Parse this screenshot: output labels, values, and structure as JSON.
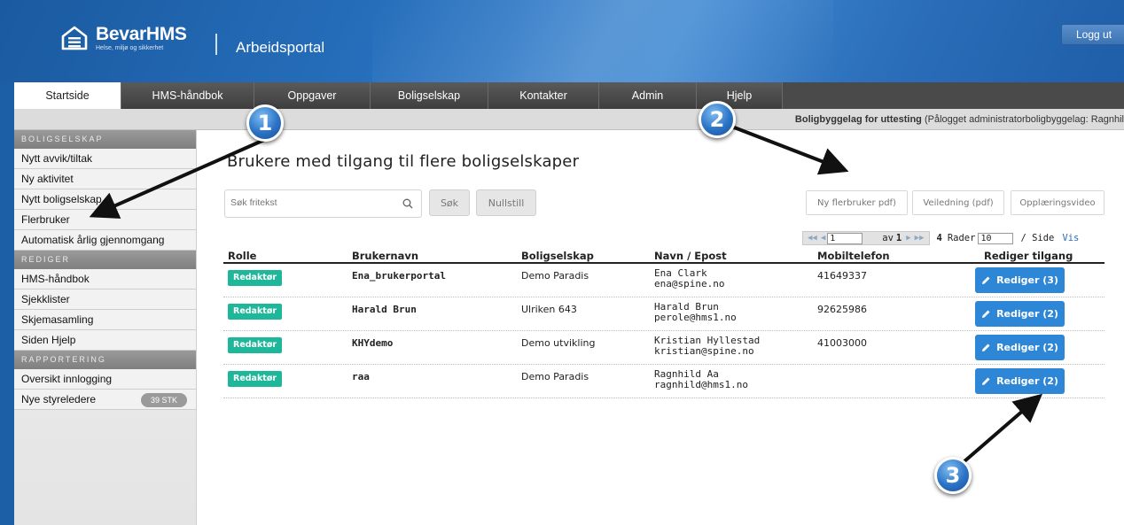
{
  "header": {
    "logo_name": "BevarHMS",
    "logo_tagline": "Helse, miljø og sikkerhet",
    "portal_title": "Arbeidsportal",
    "logout_label": "Logg ut"
  },
  "nav": {
    "items": [
      {
        "label": "Startside",
        "active": true
      },
      {
        "label": "HMS-håndbok"
      },
      {
        "label": "Oppgaver"
      },
      {
        "label": "Boligselskap"
      },
      {
        "label": "Kontakter"
      },
      {
        "label": "Admin"
      },
      {
        "label": "Hjelp"
      }
    ]
  },
  "status": {
    "org": "Boligbyggelag for uttesting",
    "login": " (Pålogget administratorboligbyggelag: Ragnhil"
  },
  "sidebar": {
    "sections": [
      {
        "title": "BOLIGSELSKAP",
        "items": [
          "Nytt avvik/tiltak",
          "Ny aktivitet",
          "Nytt boligselskap",
          "Flerbruker",
          "Automatisk årlig gjennomgang"
        ]
      },
      {
        "title": "REDIGER",
        "items": [
          "HMS-håndbok",
          "Sjekklister",
          "Skjemasamling",
          "Siden Hjelp"
        ]
      },
      {
        "title": "RAPPORTERING",
        "items": [
          "Oversikt innlogging",
          "Nye styreledere"
        ]
      }
    ],
    "badge": "39 STK"
  },
  "main": {
    "title": "Brukere med tilgang til flere boligselskaper",
    "search_placeholder": "Søk fritekst",
    "search_btn": "Søk",
    "reset_btn": "Nullstill",
    "doc_buttons": [
      "Ny flerbruker pdf)",
      "Veiledning (pdf)",
      "Opplæringsvideo"
    ]
  },
  "pager": {
    "page": "1",
    "of_label": "av",
    "total_pages": "1",
    "rows_count": "4",
    "rows_label": "Rader",
    "per_page": "10",
    "per_label": "/ Side",
    "show": "Vis"
  },
  "table": {
    "headers": [
      "Rolle",
      "Brukernavn",
      "Boligselskap",
      "Navn / Epost",
      "Mobiltelefon",
      "Rediger tilgang"
    ],
    "rows": [
      {
        "role": "Redaktør",
        "user": "Ena_brukerportal",
        "company": "Demo Paradis",
        "name": "Ena Clark",
        "email": "ena@spine.no",
        "mobile": "41649337",
        "edit": "Rediger (3)"
      },
      {
        "role": "Redaktør",
        "user": "Harald Brun",
        "company": "Ulriken 643",
        "name": "Harald Brun",
        "email": "perole@hms1.no",
        "mobile": "92625986",
        "edit": "Rediger (2)"
      },
      {
        "role": "Redaktør",
        "user": "KHYdemo",
        "company": "Demo utvikling",
        "name": "Kristian Hyllestad",
        "email": "kristian@spine.no",
        "mobile": "41003000",
        "edit": "Rediger (2)"
      },
      {
        "role": "Redaktør",
        "user": "raa",
        "company": "Demo Paradis",
        "name": "Ragnhild Aa",
        "email": "ragnhild@hms1.no",
        "mobile": "",
        "edit": "Rediger (2)"
      }
    ]
  },
  "annotations": [
    "1",
    "2",
    "3"
  ],
  "colors": {
    "brand_blue": "#1c5fa6",
    "role_green": "#1fb79a",
    "edit_blue": "#2e86d6"
  }
}
